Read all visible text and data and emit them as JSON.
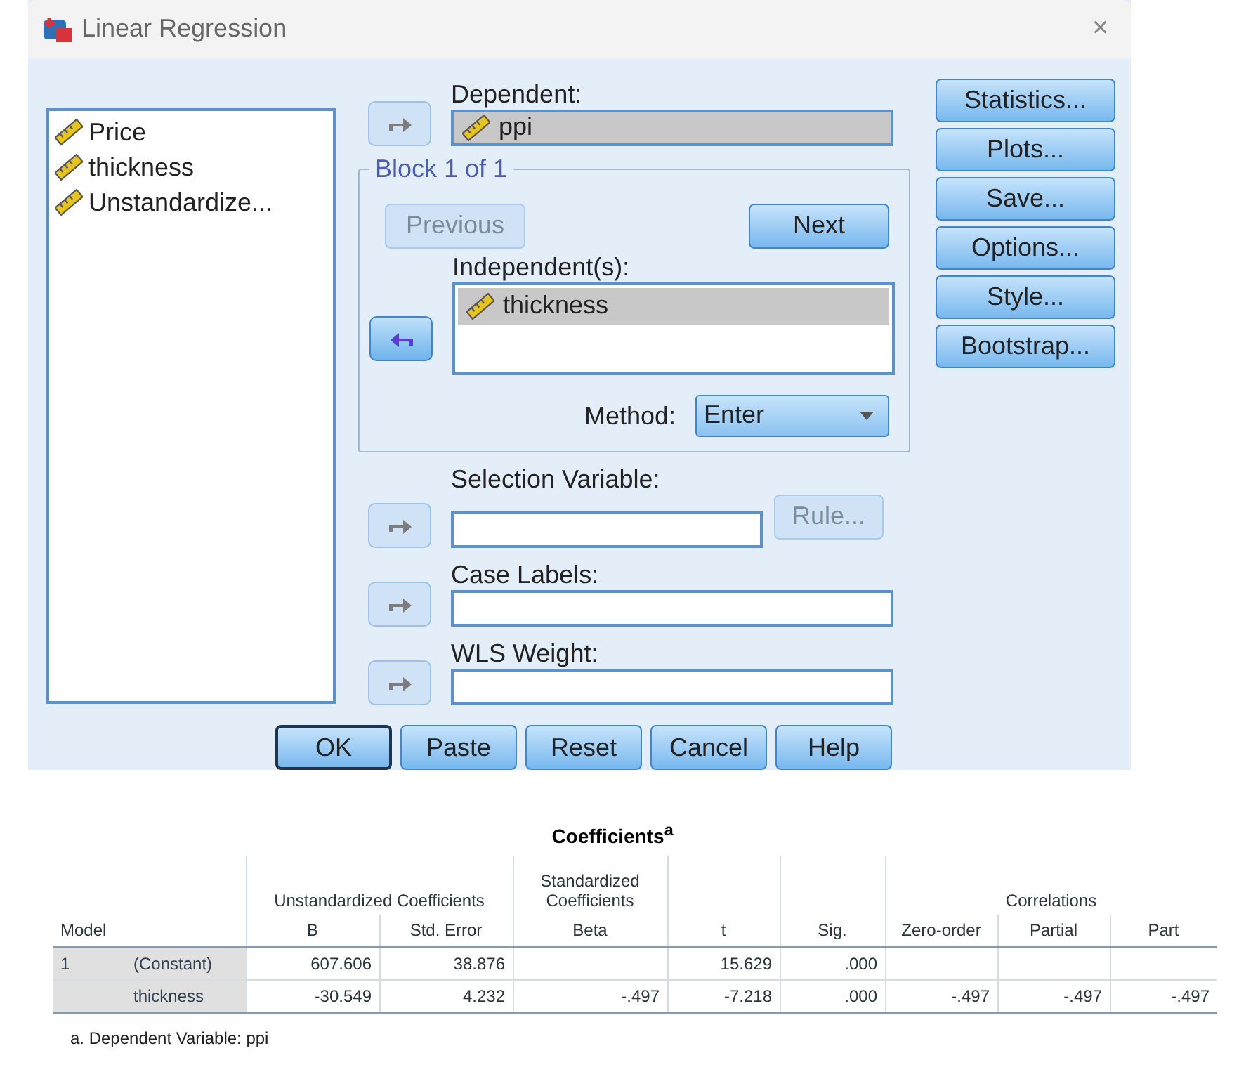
{
  "window": {
    "title": "Linear Regression",
    "close": "×"
  },
  "variables": [
    "Price",
    "thickness",
    "Unstandardize..."
  ],
  "dependent": {
    "label": "Dependent:",
    "value": "ppi",
    "arrow": {
      "points_left": false,
      "active": false
    }
  },
  "block": {
    "label": "Block 1 of 1",
    "previous": {
      "label": "Previous",
      "disabled": true
    },
    "next": {
      "label": "Next",
      "disabled": false
    },
    "independents_label": "Independent(s):",
    "independents": [
      "thickness"
    ],
    "arrow": {
      "points_left": true,
      "active": true
    },
    "method_label": "Method:",
    "method": "Enter"
  },
  "selection_variable": {
    "label": "Selection Variable:",
    "arrow": {
      "points_left": false,
      "active": false
    },
    "rule": {
      "label": "Rule...",
      "disabled": true
    }
  },
  "case_labels": {
    "label": "Case Labels:",
    "arrow": {
      "points_left": false,
      "active": false
    }
  },
  "wls_weight": {
    "label": "WLS Weight:",
    "arrow": {
      "points_left": false,
      "active": false
    }
  },
  "side_buttons": [
    "Statistics...",
    "Plots...",
    "Save...",
    "Options...",
    "Style...",
    "Bootstrap..."
  ],
  "bottom_buttons": [
    {
      "label": "OK",
      "default": true
    },
    {
      "label": "Paste",
      "default": false
    },
    {
      "label": "Reset",
      "default": false
    },
    {
      "label": "Cancel",
      "default": false
    },
    {
      "label": "Help",
      "default": false
    }
  ],
  "coefficients": {
    "title": "Coefficients$^{a}$",
    "model_header": "Model",
    "column_groups": [
      {
        "label": "Unstandardized Coefficients",
        "columns": [
          "B",
          "Std. Error"
        ]
      },
      {
        "label": "Standardized Coefficients",
        "columns": [
          "Beta"
        ]
      },
      {
        "columns": [
          "t"
        ]
      },
      {
        "columns": [
          "Sig."
        ]
      },
      {
        "label": "Correlations",
        "columns": [
          "Zero-order",
          "Partial",
          "Part"
        ]
      }
    ],
    "rows": [
      {
        "model": "1",
        "label": "(Constant)",
        "cells": {
          "b": "607.606",
          "std_error": "38.876",
          "t": "15.629",
          "sig": ".000"
        }
      },
      {
        "label": "thickness",
        "cells": {
          "b": "-30.549",
          "std_error": "4.232",
          "beta": "-.497",
          "t": "-7.218",
          "sig": ".000",
          "zero_order": "-.497",
          "partial": "-.497",
          "part": "-.497"
        }
      }
    ],
    "footnote": "a. Dependent Variable: ppi"
  }
}
